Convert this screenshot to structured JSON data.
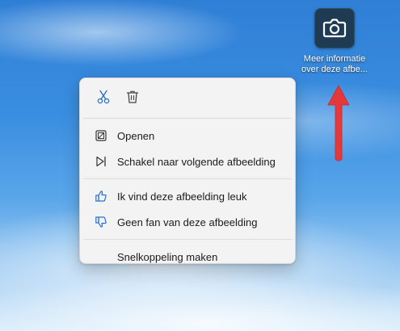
{
  "colors": {
    "accent": "#2a6fc9",
    "arrow": "#e5383b",
    "menu_bg": "#f3f3f3",
    "icon_tile": "#1f3b54"
  },
  "desktop_icon": {
    "icon": "camera-icon",
    "label": "Meer informatie over deze afbe..."
  },
  "context_menu": {
    "quick_actions": [
      {
        "icon": "scissors-icon",
        "name": "cut"
      },
      {
        "icon": "trash-icon",
        "name": "delete"
      }
    ],
    "items": [
      {
        "icon": "open-icon",
        "label": "Openen"
      },
      {
        "icon": "skip-next-icon",
        "label": "Schakel naar volgende afbeelding"
      },
      {
        "icon": "thumbs-up-icon",
        "label": "Ik vind deze afbeelding leuk"
      },
      {
        "icon": "thumbs-down-icon",
        "label": "Geen fan van deze afbeelding"
      },
      {
        "icon": "",
        "label": "Snelkoppeling maken"
      }
    ]
  }
}
